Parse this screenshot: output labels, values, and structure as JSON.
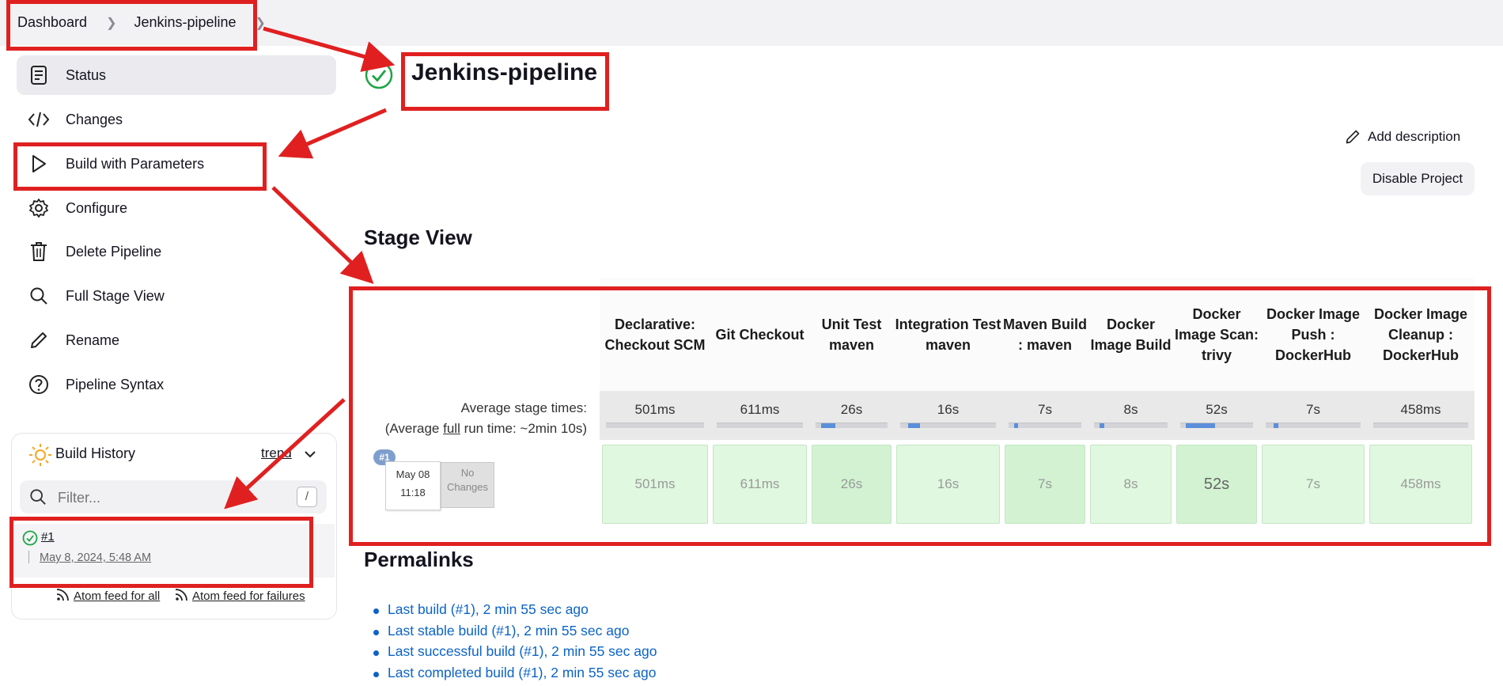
{
  "breadcrumb": {
    "items": [
      "Dashboard",
      "Jenkins-pipeline"
    ]
  },
  "sidebar": {
    "items": [
      {
        "label": "Status",
        "icon": "document-icon",
        "active": true
      },
      {
        "label": "Changes",
        "icon": "code-icon"
      },
      {
        "label": "Build with Parameters",
        "icon": "play-icon"
      },
      {
        "label": "Configure",
        "icon": "gear-icon"
      },
      {
        "label": "Delete Pipeline",
        "icon": "trash-icon"
      },
      {
        "label": "Full Stage View",
        "icon": "search-icon"
      },
      {
        "label": "Rename",
        "icon": "pencil-icon"
      },
      {
        "label": "Pipeline Syntax",
        "icon": "help-icon"
      }
    ]
  },
  "build_history": {
    "title": "Build History",
    "trend": "trend",
    "filter_placeholder": "Filter...",
    "shortcut": "/",
    "builds": [
      {
        "number": "#1",
        "date": "May 8, 2024, 5:48 AM",
        "status": "success"
      }
    ],
    "feed_all": "Atom feed for all",
    "feed_failures": "Atom feed for failures"
  },
  "main": {
    "title": "Jenkins-pipeline",
    "add_description": "Add description",
    "disable_project": "Disable Project",
    "stage_view_title": "Stage View",
    "permalinks_title": "Permalinks"
  },
  "stage_view": {
    "avg_label_line1": "Average stage times:",
    "avg_label_prefix": "(Average ",
    "avg_label_full": "full",
    "avg_label_suffix": " run time: ~2min 10s)",
    "run": {
      "badge": "#1",
      "date": "May 08",
      "time": "11:18",
      "changes": "No Changes"
    },
    "stages": [
      {
        "name": "Declarative: Checkout SCM",
        "avg": "501ms",
        "run": "501ms",
        "bar_fraction": 0.0
      },
      {
        "name": "Git Checkout",
        "avg": "611ms",
        "run": "611ms",
        "bar_fraction": 0.0
      },
      {
        "name": "Unit Test maven",
        "avg": "26s",
        "run": "26s",
        "bar_fraction": 0.2
      },
      {
        "name": "Integration Test maven",
        "avg": "16s",
        "run": "16s",
        "bar_fraction": 0.12
      },
      {
        "name": "Maven Build : maven",
        "avg": "7s",
        "run": "7s",
        "bar_fraction": 0.05
      },
      {
        "name": "Docker Image Build",
        "avg": "8s",
        "run": "8s",
        "bar_fraction": 0.06
      },
      {
        "name": "Docker Image Scan: trivy",
        "avg": "52s",
        "run": "52s",
        "bar_fraction": 0.4
      },
      {
        "name": "Docker Image Push : DockerHub",
        "avg": "7s",
        "run": "7s",
        "bar_fraction": 0.05
      },
      {
        "name": "Docker Image Cleanup : DockerHub",
        "avg": "458ms",
        "run": "458ms",
        "bar_fraction": 0.0
      }
    ]
  },
  "permalinks": [
    "Last build (#1), 2 min 55 sec ago",
    "Last stable build (#1), 2 min 55 sec ago",
    "Last successful build (#1), 2 min 55 sec ago",
    "Last completed build (#1), 2 min 55 sec ago"
  ],
  "colors": {
    "annotation": "#e02020",
    "link": "#0b63c8",
    "success": "#1ea446",
    "stage_success": "#dff8df"
  }
}
